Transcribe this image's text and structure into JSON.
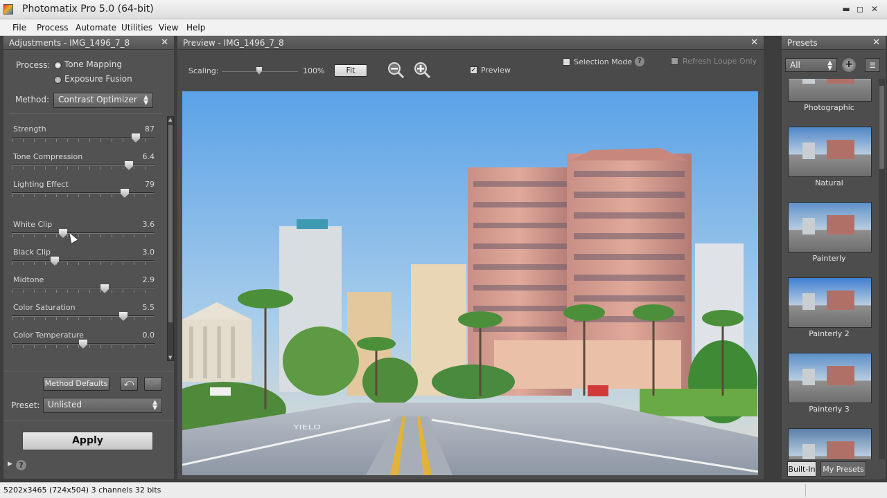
{
  "window": {
    "title": "Photomatix Pro 5.0 (64-bit)",
    "minimize": "▬",
    "maximize": "◻",
    "close": "✕"
  },
  "menu": [
    "File",
    "Process",
    "Automate",
    "Utilities",
    "View",
    "Help"
  ],
  "adjustments": {
    "title": "Adjustments - IMG_1496_7_8",
    "process_label": "Process:",
    "process_options": [
      "Tone Mapping",
      "Exposure Fusion"
    ],
    "process_selected": "Tone Mapping",
    "method_label": "Method:",
    "method_value": "Contrast Optimizer",
    "sliders": [
      {
        "name": "Strength",
        "value": "87",
        "pos": 0.87
      },
      {
        "name": "Tone Compression",
        "value": "6.4",
        "pos": 0.82
      },
      {
        "name": "Lighting Effect",
        "value": "79",
        "pos": 0.79
      },
      {
        "name": "White Clip",
        "value": "3.6",
        "pos": 0.36
      },
      {
        "name": "Black Clip",
        "value": "3.0",
        "pos": 0.3
      },
      {
        "name": "Midtone",
        "value": "2.9",
        "pos": 0.65
      },
      {
        "name": "Color Saturation",
        "value": "5.5",
        "pos": 0.78
      },
      {
        "name": "Color Temperature",
        "value": "0.0",
        "pos": 0.5
      }
    ],
    "method_defaults": "Method Defaults",
    "preset_label": "Preset:",
    "preset_value": "Unlisted",
    "apply": "Apply"
  },
  "preview": {
    "title": "Preview - IMG_1496_7_8",
    "scaling_label": "Scaling:",
    "scaling_value": "100%",
    "fit": "Fit",
    "preview_checkbox": "Preview",
    "preview_checked": true,
    "selection_mode": "Selection Mode",
    "refresh_loupe": "Refresh Loupe Only",
    "street_text": "YIELD"
  },
  "presets": {
    "title": "Presets",
    "filter": "All",
    "items": [
      "Photographic",
      "Natural",
      "Painterly",
      "Painterly 2",
      "Painterly 3"
    ],
    "tabs": [
      "Built-In",
      "My Presets"
    ],
    "active_tab": "Built-In"
  },
  "status": {
    "text": "5202x3465 (724x504) 3 channels 32 bits"
  }
}
